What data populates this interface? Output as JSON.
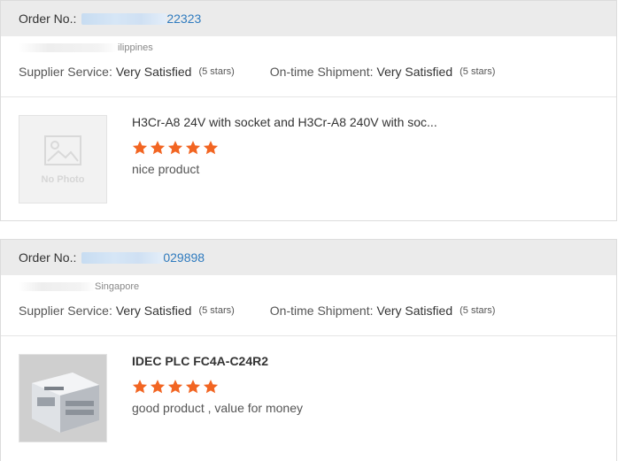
{
  "orders": [
    {
      "order_label": "Order No.:",
      "order_number_visible": "22323",
      "address_visible": "ilippines",
      "supplier_service_label": "Supplier Service:",
      "supplier_service_value": "Very Satisfied",
      "supplier_service_stars": "(5 stars)",
      "shipment_label": "On-time Shipment:",
      "shipment_value": "Very Satisfied",
      "shipment_stars": "(5 stars)",
      "product_title": "H3Cr-A8 24V with socket and H3Cr-A8 240V with soc...",
      "thumbnail": "No Photo",
      "rating": 5,
      "review": "nice product"
    },
    {
      "order_label": "Order No.:",
      "order_number_visible": "029898",
      "address_visible": "Singapore",
      "supplier_service_label": "Supplier Service:",
      "supplier_service_value": "Very Satisfied",
      "supplier_service_stars": "(5 stars)",
      "shipment_label": "On-time Shipment:",
      "shipment_value": "Very Satisfied",
      "shipment_stars": "(5 stars)",
      "product_title": "IDEC PLC FC4A-C24R2",
      "rating": 5,
      "review": "good product , value for money"
    }
  ],
  "colors": {
    "star": "#f26522",
    "order_number": "#2f7bbf",
    "header_bg": "#ebebeb"
  }
}
